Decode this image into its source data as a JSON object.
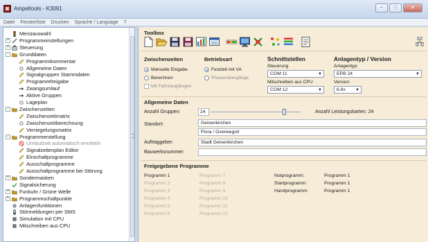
{
  "window": {
    "title": "Ampeltools - K3091"
  },
  "menu": [
    "Datei",
    "Fensterliste",
    "Drucken",
    "Sprache / Language",
    "?"
  ],
  "tree": [
    {
      "label": "Menüauswahl",
      "icon": "signal-icon",
      "level": 0,
      "expander": "",
      "dimmed": false
    },
    {
      "label": "Programmeinstellungen",
      "icon": "tools-icon",
      "level": 0,
      "expander": "+",
      "dimmed": false
    },
    {
      "label": "Steuerung",
      "icon": "controller-icon",
      "level": 0,
      "expander": "+",
      "dimmed": false
    },
    {
      "label": "Grunddaten",
      "icon": "folder-icon",
      "level": 0,
      "expander": "-",
      "dimmed": false
    },
    {
      "label": "Programmkommentar",
      "icon": "pencil-icon",
      "level": 1,
      "expander": "",
      "dimmed": false
    },
    {
      "label": "Allgemeine Daten",
      "icon": "circle-icon",
      "level": 1,
      "expander": "",
      "dimmed": false
    },
    {
      "label": "Signalgruppen Stammdaten",
      "icon": "pencil-icon",
      "level": 1,
      "expander": "",
      "dimmed": false
    },
    {
      "label": "Programmfreigabe",
      "icon": "pencil-icon",
      "level": 1,
      "expander": "",
      "dimmed": false
    },
    {
      "label": "Zwangsumlauf",
      "icon": "arrow-icon",
      "level": 1,
      "expander": "",
      "dimmed": false
    },
    {
      "label": "Aktive Gruppen",
      "icon": "arrow-icon",
      "level": 1,
      "expander": "",
      "dimmed": false
    },
    {
      "label": "Lageplan",
      "icon": "circle-icon",
      "level": 1,
      "expander": "",
      "dimmed": false
    },
    {
      "label": "Zwischenzeiten",
      "icon": "folder-icon",
      "level": 0,
      "expander": "-",
      "dimmed": false
    },
    {
      "label": "Zwischenzeitmatrix",
      "icon": "pencil-icon",
      "level": 1,
      "expander": "",
      "dimmed": false
    },
    {
      "label": "Zwischenzeitberechnung",
      "icon": "circle-icon",
      "level": 1,
      "expander": "",
      "dimmed": false
    },
    {
      "label": "Verriegelungsmatrix",
      "icon": "pencil-icon",
      "level": 1,
      "expander": "",
      "dimmed": false
    },
    {
      "label": "Programmerstellung",
      "icon": "folder-icon",
      "level": 0,
      "expander": "-",
      "dimmed": false
    },
    {
      "label": "Umlaufzeit automatisch ermitteln",
      "icon": "forbidden-icon",
      "level": 1,
      "expander": "",
      "dimmed": true
    },
    {
      "label": "Signalzeitenplan Editor",
      "icon": "pencil-icon",
      "level": 1,
      "expander": "",
      "dimmed": false
    },
    {
      "label": "Einschaltprogramme",
      "icon": "pencil-icon",
      "level": 1,
      "expander": "",
      "dimmed": false
    },
    {
      "label": "Ausschaltprogramme",
      "icon": "pencil-icon",
      "level": 1,
      "expander": "",
      "dimmed": false
    },
    {
      "label": "Ausschaltprogramme bei Störung",
      "icon": "pencil-icon",
      "level": 1,
      "expander": "",
      "dimmed": false
    },
    {
      "label": "Sondermasken",
      "icon": "folder-icon",
      "level": 0,
      "expander": "+",
      "dimmed": false
    },
    {
      "label": "Signalsicherung",
      "icon": "check-icon",
      "level": 0,
      "expander": "",
      "dimmed": false
    },
    {
      "label": "Funkuhr / Grüne Welle",
      "icon": "folder-icon",
      "level": 0,
      "expander": "+",
      "dimmed": false
    },
    {
      "label": "Programmschaltpunkte",
      "icon": "folder-icon",
      "level": 0,
      "expander": "+",
      "dimmed": false
    },
    {
      "label": "Anlagenfunktionen",
      "icon": "gear-icon",
      "level": 0,
      "expander": "",
      "dimmed": false
    },
    {
      "label": "Störmeldungen per SMS",
      "icon": "phone-icon",
      "level": 0,
      "expander": "",
      "dimmed": false
    },
    {
      "label": "Simulation mit CPU",
      "icon": "cpu-icon",
      "level": 0,
      "expander": "",
      "dimmed": false
    },
    {
      "label": "Mitschreiben aus CPU",
      "icon": "cpu-icon",
      "level": 0,
      "expander": "",
      "dimmed": false
    }
  ],
  "toolbox": {
    "title": "Toolbox",
    "icons": [
      "new-document-icon",
      "open-folder-icon",
      "save-icon",
      "save-as-icon",
      "chart-icon",
      "window-icon",
      "signal-sequence-icon",
      "monitor-icon",
      "traffic-light-icon",
      "dots-icon",
      "list-icon",
      "print-icon"
    ]
  },
  "zwischenzeiten": {
    "title": "Zwischenzeiten",
    "options": [
      {
        "label": "Manuelle Eingabe",
        "selected": true
      },
      {
        "label": "Berechnen",
        "selected": false
      }
    ],
    "checkbox": {
      "label": "Mit Fahrzeuglängen",
      "checked": false
    }
  },
  "betriebsart": {
    "title": "Betriebsart",
    "options": [
      {
        "label": "Festzeit mit VA",
        "selected": true
      },
      {
        "label": "Phasenübergänge",
        "selected": false
      }
    ]
  },
  "schnittstellen": {
    "title": "Schnittstellen",
    "steuerung_label": "Steuerung",
    "steuerung_value": "COM 11",
    "mitschreiben_label": "Mitschreiben aus CPU",
    "mitschreiben_value": "COM 12"
  },
  "anlagentyp": {
    "title": "Anlagentyp / Version",
    "typ_label": "Anlagentyp:",
    "typ_value": "EPB 24",
    "version_label": "Version:",
    "version_value": "6.8x"
  },
  "allgemeine_daten": {
    "title": "Allgemeine Daten",
    "anzahl_label": "Anzahl Gruppen:",
    "anzahl_value": "24",
    "anzahl_fraction": 0.83,
    "leistungskarten_label": "Anzahl Leistungskarten: 24",
    "standort_label": "Standort:",
    "standort_value": "Gelsenkirchen",
    "standort_value2": "Flora / Overwegstr",
    "auftraggeber_label": "Auftraggeber:",
    "auftraggeber_value": "Stadt Gelsenkirchen",
    "bauwerksnummer_label": "Bauwerksnummer:",
    "bauwerksnummer_value": ""
  },
  "freigegebene": {
    "title": "Freigegebene Programme",
    "col1": [
      {
        "label": "Programm 1",
        "active": true
      },
      {
        "label": "Programm 2",
        "active": false
      },
      {
        "label": "Programm 3",
        "active": false
      },
      {
        "label": "Programm 4",
        "active": false
      },
      {
        "label": "Programm 5",
        "active": false
      },
      {
        "label": "Programm 6",
        "active": false
      }
    ],
    "col2": [
      {
        "label": "Programm 7",
        "active": false
      },
      {
        "label": "Programm 8",
        "active": false
      },
      {
        "label": "Programm 9",
        "active": false
      },
      {
        "label": "Programm 10",
        "active": false
      },
      {
        "label": "Programm 11",
        "active": false
      },
      {
        "label": "Programm 12",
        "active": false
      }
    ],
    "special": [
      {
        "label": "Notprogramm:",
        "value": "Programm 1"
      },
      {
        "label": "Startprogramm:",
        "value": "Programm 1"
      },
      {
        "label": "Handprogramm:",
        "value": "Programm 1"
      }
    ]
  },
  "colors": {
    "accent": "#2b59c3",
    "panel_bg": "#f7ecd8",
    "title_bar": "#c7d6ec",
    "folder": "#c29a2a"
  }
}
